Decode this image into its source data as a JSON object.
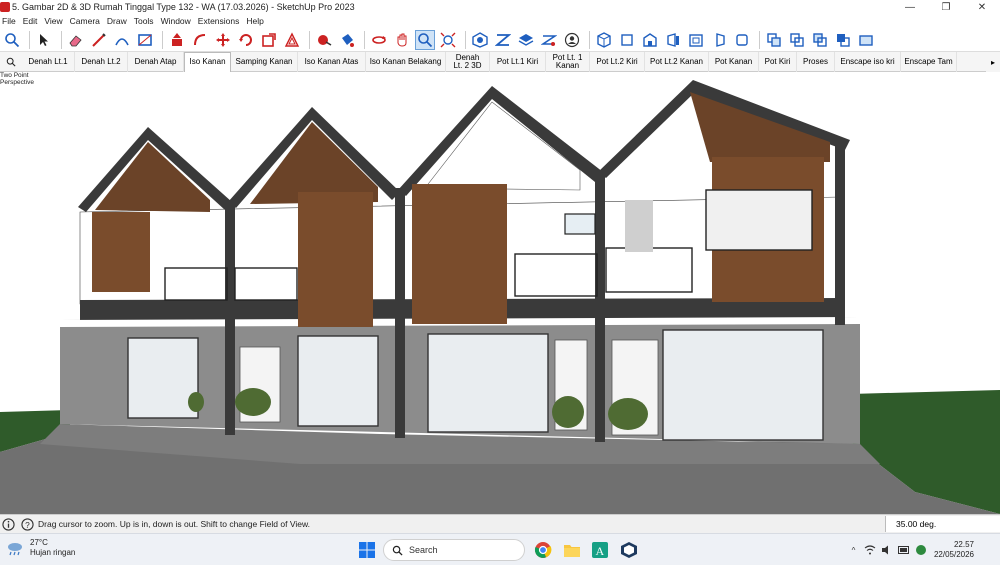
{
  "window": {
    "title": "5. Gambar 2D & 3D Rumah Tinggal Type 132 - WA  (17.03.2026) - SketchUp Pro 2023",
    "minimize": "—",
    "maximize": "❐",
    "close": "✕"
  },
  "menu": [
    "File",
    "Edit",
    "View",
    "Camera",
    "Draw",
    "Tools",
    "Window",
    "Extensions",
    "Help"
  ],
  "scenes": {
    "tabs": [
      "Denah Lt.1",
      "Denah Lt.2",
      "Denah Atap",
      "Iso Kanan",
      "Samping Kanan",
      "Iso Kanan Atas",
      "Iso Kanan Belakang",
      "Denah Lt. 2 3D",
      "Pot Lt.1 Kiri",
      "Pot Lt. 1 Kanan",
      "Pot Lt.2 Kiri",
      "Pot Lt.2 Kanan",
      "Pot Kanan",
      "Pot Kiri",
      "Proses",
      "Enscape iso kri",
      "Enscape Tam"
    ],
    "active": "Iso Kanan",
    "more": "▸"
  },
  "viewport": {
    "camera_mode_line1": "Two Point",
    "camera_mode_line2": "Perspective"
  },
  "status": {
    "hint": "Drag cursor to zoom.  Up is in, down is out. Shift to change Field of View.",
    "measurement_value": "35.00 deg."
  },
  "taskbar": {
    "temperature": "27°C",
    "weather_condition": "Hujan ringan",
    "search_placeholder": "Search",
    "time": "22.57",
    "date": "22/05/2026"
  },
  "colors": {
    "accent_blue": "#1f5fbf",
    "sky": "#ffffff",
    "grass": "#2f5b2a",
    "road": "#6e6e6e",
    "wall_grey": "#8c8c8c",
    "wood": "#6b4328",
    "roof_dark": "#3a3a3a"
  }
}
